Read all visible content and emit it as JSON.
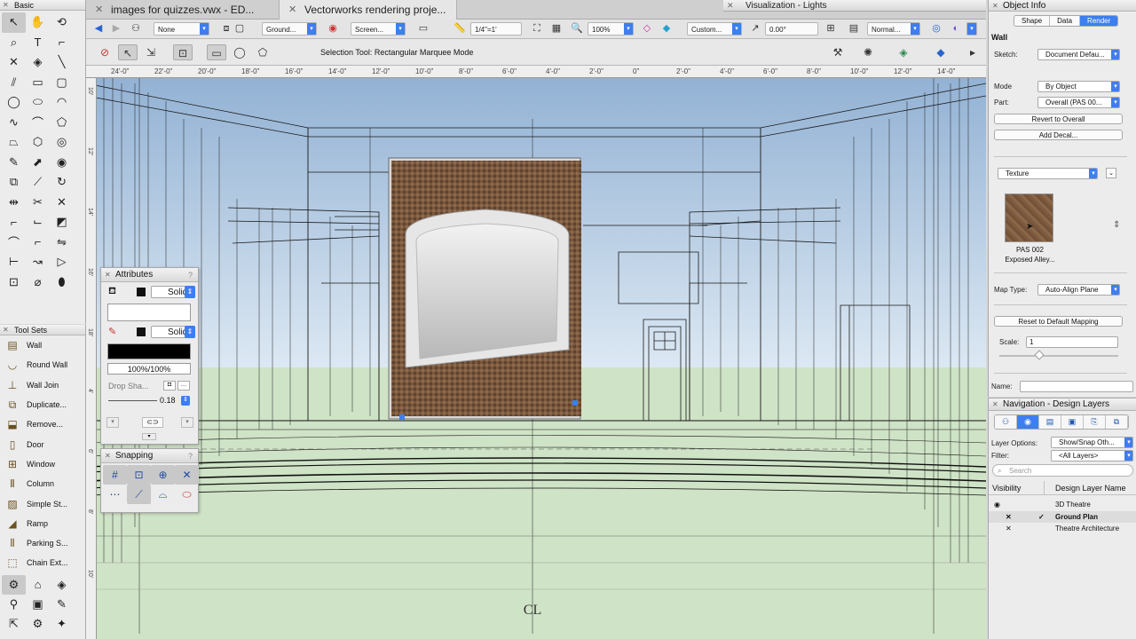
{
  "basic_palette": {
    "title": "Basic",
    "tools": [
      "arrow-cursor-icon",
      "hand-pan-icon",
      "flyover-icon",
      "zoom-icon",
      "text-tool-icon",
      "callout-icon",
      "close-icon",
      "attribute-mapping-icon",
      "line-icon",
      "double-line-icon",
      "rectangle-icon",
      "rounded-rect-icon",
      "circle-icon",
      "oval-icon",
      "arc-icon",
      "freehand-icon",
      "polyline-icon",
      "polygon-icon",
      "double-line-polygon-icon",
      "regular-polygon-icon",
      "spiral-icon",
      "eyedropper-icon",
      "reshape-icon",
      "visibility-icon",
      "offset-icon",
      "trim-icon",
      "rotate-icon",
      "mirror-icon",
      "split-icon",
      "connect-icon",
      "fillet-icon",
      "chamfer-icon",
      "clip-icon",
      "clip-line-icon",
      "select-similar-icon",
      "move-by-points-icon",
      "dimension-icon",
      "constrained-icon",
      "gradient-icon",
      "loci-icon",
      "bezier-icon",
      "paint-bucket-icon"
    ]
  },
  "tool_sets": {
    "title": "Tool Sets",
    "items": [
      {
        "label": "Wall",
        "icon": "wall-icon"
      },
      {
        "label": "Round Wall",
        "icon": "round-wall-icon"
      },
      {
        "label": "Wall Join",
        "icon": "wall-join-icon"
      },
      {
        "label": "Duplicate...",
        "icon": "duplicate-icon"
      },
      {
        "label": "Remove...",
        "icon": "remove-icon"
      },
      {
        "label": "Door",
        "icon": "door-icon"
      },
      {
        "label": "Window",
        "icon": "window-icon"
      },
      {
        "label": "Column",
        "icon": "column-icon"
      },
      {
        "label": "Simple St...",
        "icon": "stair-icon"
      },
      {
        "label": "Ramp",
        "icon": "ramp-icon"
      },
      {
        "label": "Parking S...",
        "icon": "parking-icon"
      },
      {
        "label": "Chain Ext...",
        "icon": "chain-extrude-icon"
      }
    ]
  },
  "tabs": [
    {
      "label": "images for quizzes.vwx - ED...",
      "active": false
    },
    {
      "label": "Vectorworks rendering proje...",
      "active": true
    }
  ],
  "view_bar": {
    "class": "None",
    "layer": "Ground...",
    "view": "Screen...",
    "scale": "1/4\"=1'",
    "zoom": "100%",
    "render": "Custom...",
    "angle": "0.00°",
    "mode": "Normal..."
  },
  "mode_bar": {
    "status": "Selection Tool: Rectangular Marquee Mode"
  },
  "ruler": {
    "top_ticks": [
      "24'-0\"",
      "22'-0\"",
      "20'-0\"",
      "18'-0\"",
      "16'-0\"",
      "14'-0\"",
      "12'-0\"",
      "10'-0\"",
      "8'-0\"",
      "6'-0\"",
      "4'-0\"",
      "2'-0\"",
      "0\"",
      "2'-0\"",
      "4'-0\"",
      "6'-0\"",
      "8'-0\"",
      "10'-0\"",
      "12'-0\"",
      "14'-0\""
    ],
    "left_ticks": [
      "10'",
      "12'",
      "14'",
      "16'",
      "18'",
      "4'",
      "6'",
      "8'",
      "10'"
    ]
  },
  "attributes": {
    "title": "Attributes",
    "fill_style": "Solid",
    "pen_style": "Solid",
    "opacity": "100%/100%",
    "drop_shadow_label": "Drop Sha...",
    "line_weight": "0.18"
  },
  "snapping": {
    "title": "Snapping"
  },
  "viz_palette": {
    "title": "Visualization - Lights"
  },
  "object_info": {
    "title": "Object Info",
    "tabs": [
      "Shape",
      "Data",
      "Render"
    ],
    "active_tab": "Render",
    "object_type": "Wall",
    "sketch_label": "Sketch:",
    "sketch_value": "Document Defau...",
    "mode_label": "Mode",
    "mode_value": "By Object",
    "part_label": "Part:",
    "part_value": "Overall (PAS 00...",
    "revert_button": "Revert to Overall",
    "add_decal_button": "Add Decal...",
    "texture_label": "Texture",
    "texture_name": "PAS 002",
    "texture_subname": "Exposed Alley...",
    "map_type_label": "Map Type:",
    "map_type_value": "Auto-Align Plane",
    "reset_button": "Reset to Default Mapping",
    "scale_label": "Scale:",
    "scale_value": "1",
    "name_label": "Name:",
    "name_value": ""
  },
  "navigation": {
    "title": "Navigation - Design Layers",
    "layer_options_label": "Layer Options:",
    "layer_options_value": "Show/Snap Oth...",
    "filter_label": "Filter:",
    "filter_value": "<All Layers>",
    "search_placeholder": "Search",
    "col_visibility": "Visibility",
    "col_name": "Design Layer Name",
    "layers": [
      {
        "name": "3D Theatre",
        "visibility": "eye",
        "active": false
      },
      {
        "name": "Ground Plan",
        "visibility": "x",
        "active": true
      },
      {
        "name": "Theatre Architecture",
        "visibility": "x",
        "active": false
      }
    ]
  },
  "canvas": {
    "centerline_symbol": "CL"
  }
}
